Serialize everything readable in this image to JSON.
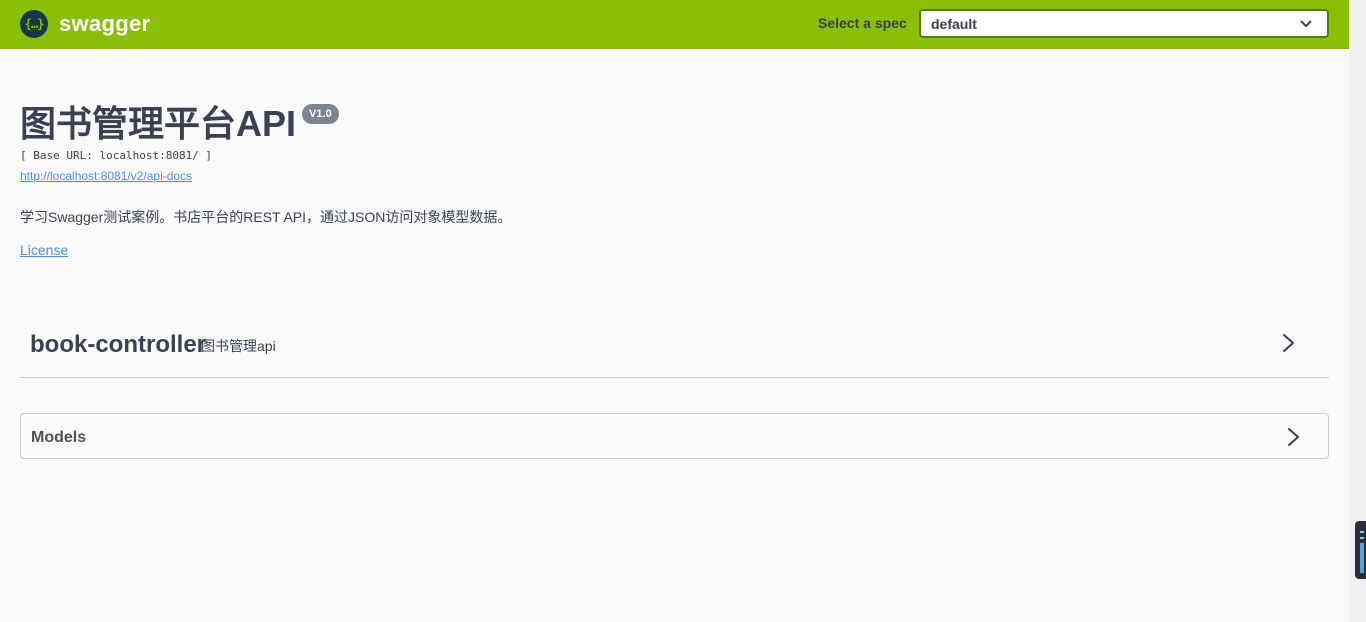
{
  "topbar": {
    "logo_mark": "{…}",
    "logo_text": "swagger",
    "spec_label": "Select a spec",
    "spec_selected": "default",
    "brand_color": "#89bf04"
  },
  "info": {
    "title": "图书管理平台API",
    "version": "V1.0",
    "base_url": "[ Base URL: localhost:8081/ ]",
    "api_docs_link": "http://localhost:8081/v2/api-docs",
    "description": "学习Swagger测试案例。书店平台的REST API，通过JSON访问对象模型数据。",
    "license": "License",
    "link_color": "#4990e2"
  },
  "tags": [
    {
      "name": "book-controller",
      "description": "图书管理api"
    }
  ],
  "models": {
    "title": "Models"
  },
  "icons": {
    "spec_dropdown": "chevron-down-icon",
    "tag_expand": "chevron-right-icon",
    "models_expand": "chevron-right-icon"
  }
}
